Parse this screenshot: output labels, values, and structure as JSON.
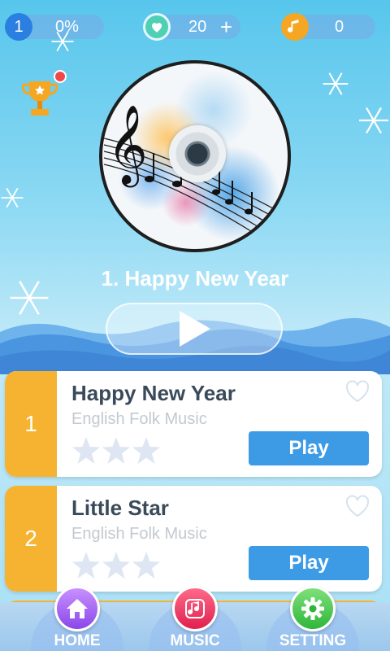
{
  "status": {
    "level": "1",
    "progress": "0%",
    "lives": "20",
    "lives_add": "+",
    "notes": "0"
  },
  "now_playing": {
    "title": "1. Happy New Year"
  },
  "songs": [
    {
      "number": "1",
      "title": "Happy New Year",
      "artist": "English Folk Music",
      "stars": 0,
      "max_stars": 3,
      "favorite": false,
      "play_label": "Play"
    },
    {
      "number": "2",
      "title": "Little Star",
      "artist": "English Folk Music",
      "stars": 0,
      "max_stars": 3,
      "favorite": false,
      "play_label": "Play"
    }
  ],
  "nav": {
    "home": "HOME",
    "music": "MUSIC",
    "setting": "SETTING"
  },
  "icons": {
    "level": "circle-badge",
    "lives": "heart-icon",
    "notes": "music-note-icon",
    "trophy": "trophy-icon",
    "play": "play-triangle-icon",
    "favorite": "heart-outline-icon",
    "star": "star-icon",
    "home": "house-icon",
    "music": "music-note-icon",
    "setting": "gear-icon"
  },
  "colors": {
    "accent_orange": "#f5b331",
    "play_blue": "#3d9be6",
    "notification_red": "#f04848"
  }
}
